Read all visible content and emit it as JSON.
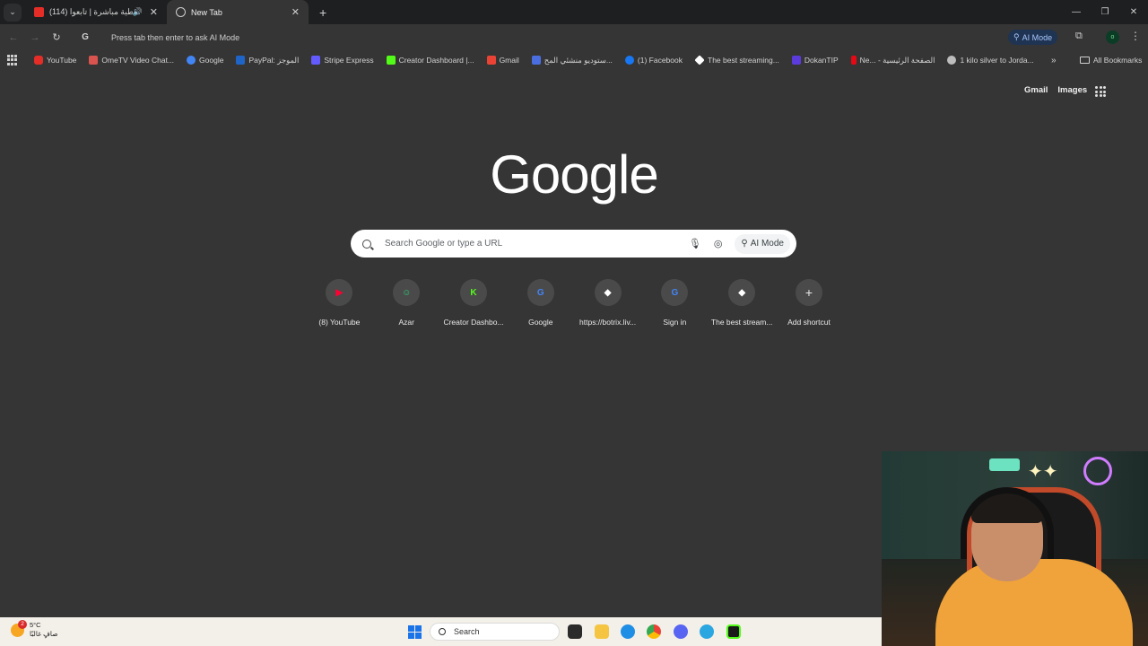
{
  "tabs": [
    {
      "title": "(114) تغطية مباشرة | تابعوا...",
      "active": false,
      "favicon": "youtube-icon",
      "audio": true
    },
    {
      "title": "New Tab",
      "active": true,
      "favicon": "chrome-icon"
    }
  ],
  "omnibox": {
    "text": "Press tab then enter to ask AI Mode"
  },
  "toolbar": {
    "ai_mode_label": "AI Mode",
    "profile_initial": "o"
  },
  "bookmarks": [
    {
      "label": "YouTube",
      "color": "#e52d27"
    },
    {
      "label": "OmeTV Video Chat...",
      "color": "#d9534f"
    },
    {
      "label": "Google",
      "color": "#4285f4"
    },
    {
      "label": "PayPal: الموجز",
      "color": "#1f64c7"
    },
    {
      "label": "Stripe Express",
      "color": "#635bff"
    },
    {
      "label": "Creator Dashboard |...",
      "color": "#53fc18"
    },
    {
      "label": "Gmail",
      "color": "#ea4335"
    },
    {
      "label": "ستوديو منشئي المح...",
      "color": "#4a6ee0"
    },
    {
      "label": "(1) Facebook",
      "color": "#1877f2"
    },
    {
      "label": "The best streaming...",
      "color": "#ffffff"
    },
    {
      "label": "DokanTIP",
      "color": "#5c3bdc"
    },
    {
      "label": "Ne... - الصفحة الرئيسية",
      "color": "#e50914"
    },
    {
      "label": "1 kilo silver to Jorda...",
      "color": "#bdbdbd"
    }
  ],
  "bookmarks_all": "All Bookmarks",
  "ntp": {
    "links": [
      "Gmail",
      "Images"
    ],
    "logo": "Google",
    "search_placeholder": "Search Google or type a URL",
    "ai_mode": "AI Mode"
  },
  "shortcuts": [
    {
      "label": "(8) YouTube",
      "icon": "youtube-icon",
      "color": "#ff0033",
      "glyph": "▶"
    },
    {
      "label": "Azar",
      "icon": "azar-icon",
      "color": "#2fd07a",
      "glyph": "☺"
    },
    {
      "label": "Creator Dashbo...",
      "icon": "kick-icon",
      "color": "#53fc18",
      "glyph": "K"
    },
    {
      "label": "Google",
      "icon": "google-icon",
      "color": "#4285f4",
      "glyph": "G"
    },
    {
      "label": "https://botrix.liv...",
      "icon": "botrix-icon",
      "color": "#ffffff",
      "glyph": "◆"
    },
    {
      "label": "Sign in",
      "icon": "google-icon",
      "color": "#4285f4",
      "glyph": "G"
    },
    {
      "label": "The best stream...",
      "icon": "streaming-icon",
      "color": "#ffffff",
      "glyph": "◆"
    },
    {
      "label": "Add shortcut",
      "icon": "plus-icon",
      "color": "#e8e8e8",
      "glyph": "+"
    }
  ],
  "taskbar": {
    "weather_temp": "5°C",
    "weather_desc": "صافٍ غالبًا",
    "weather_badge": "2",
    "search_label": "Search"
  }
}
